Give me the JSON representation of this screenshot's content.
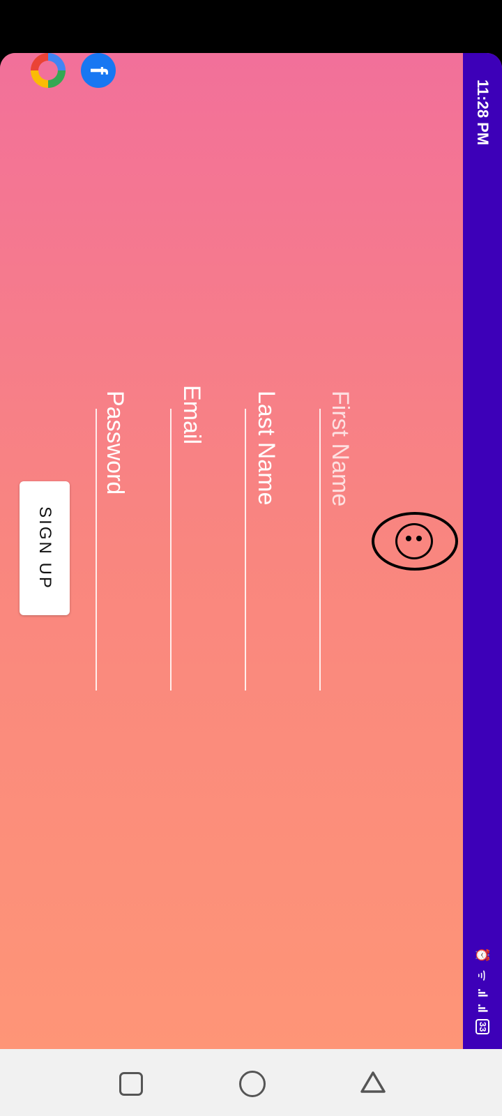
{
  "status_bar": {
    "time": "11:28 PM",
    "icons": [
      "alarm-icon",
      "wifi-icon",
      "signal-icon",
      "signal-icon",
      "battery-icon"
    ],
    "battery": "33",
    "background": "#3d00b8"
  },
  "social": {
    "google": "G",
    "facebook": "f"
  },
  "form": {
    "first_name_placeholder": "First Name",
    "last_name_placeholder": "Last Name",
    "email_placeholder": "Email",
    "password_placeholder": "Password",
    "signup_label": "SIGN UP"
  },
  "theme": {
    "gradient_start": "#f2709a",
    "gradient_end": "#fe9577"
  },
  "nav": {
    "items": [
      "recents-icon",
      "home-icon",
      "back-icon"
    ]
  }
}
